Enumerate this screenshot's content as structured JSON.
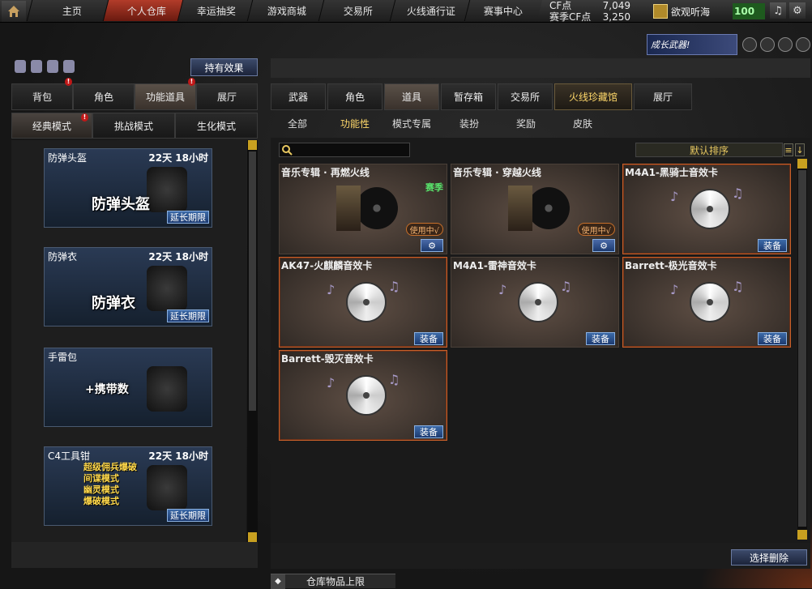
{
  "topnav": {
    "tabs": [
      "主页",
      "个人仓库",
      "幸运抽奖",
      "游戏商城",
      "交易所",
      "火线通行证",
      "赛事中心"
    ],
    "active": "个人仓库",
    "cf_label": "CF点",
    "cf_value": "7,049",
    "season_cf_label": "赛季CF点",
    "season_cf_value": "3,250",
    "username": "欲观听海",
    "level": "100"
  },
  "banner": {
    "text": "成长武器!"
  },
  "left": {
    "effects_button": "持有效果",
    "tabs": [
      "背包",
      "角色",
      "功能道具",
      "展厅"
    ],
    "active_tab": "功能道具",
    "modes": [
      "经典模式",
      "挑战模式",
      "生化模式"
    ],
    "active_mode": "经典模式",
    "cards": [
      {
        "name": "防弹头盔",
        "time": "22天 18小时",
        "big": "防弹头盔",
        "extend": "延长期限"
      },
      {
        "name": "防弹衣",
        "time": "22天 18小时",
        "big": "防弹衣",
        "extend": "延长期限"
      },
      {
        "name": "手雷包",
        "time": "",
        "big": "+携带数",
        "extend": ""
      },
      {
        "name": "C4工具钳",
        "time": "22天 18小时",
        "big": "",
        "extend": "延长期限",
        "modes": [
          "超级佣兵爆破",
          "间谍模式",
          "幽灵模式",
          "爆破模式"
        ]
      }
    ]
  },
  "right": {
    "tabs": [
      "武器",
      "角色",
      "道具",
      "暂存箱",
      "交易所",
      "火线珍藏馆",
      "展厅"
    ],
    "active_tab": "道具",
    "subtabs": [
      "全部",
      "功能性",
      "模式专属",
      "装扮",
      "奖励",
      "皮肤"
    ],
    "active_subtab": "功能性",
    "sort_label": "默认排序",
    "items": [
      {
        "name": "音乐专辑 · 再燃火线",
        "kind": "album",
        "season": "赛季",
        "status": "使用中",
        "action": "⚙"
      },
      {
        "name": "音乐专辑 · 穿越火线",
        "kind": "album",
        "season": "",
        "status": "使用中",
        "action": "⚙"
      },
      {
        "name": "M4A1-黑骑士音效卡",
        "kind": "card",
        "season": "",
        "status": "",
        "action": "装备"
      },
      {
        "name": "AK47-火麒麟音效卡",
        "kind": "card",
        "season": "",
        "status": "",
        "action": "装备"
      },
      {
        "name": "M4A1-雷神音效卡",
        "kind": "card",
        "season": "",
        "status": "",
        "action": "装备"
      },
      {
        "name": "Barrett-极光音效卡",
        "kind": "card",
        "season": "",
        "status": "",
        "action": "装备"
      },
      {
        "name": "Barrett-毁灭音效卡",
        "kind": "card",
        "season": "",
        "status": "",
        "action": "装备"
      }
    ],
    "select_delete": "选择删除",
    "storage_upper": "仓库物品上限"
  }
}
